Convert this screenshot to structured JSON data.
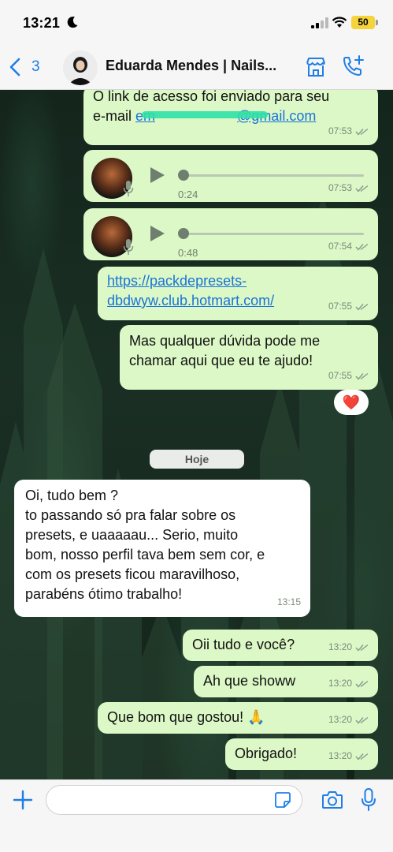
{
  "status_bar": {
    "time": "13:21",
    "battery": "50",
    "icons": [
      "moon-icon",
      "signal-icon",
      "wifi-icon",
      "battery-icon"
    ]
  },
  "header": {
    "back_count": "3",
    "contact_name": "Eduarda Mendes | Nails...",
    "icons": [
      "chevron-left-icon",
      "store-icon",
      "add-call-icon"
    ]
  },
  "chat": {
    "messages": [
      {
        "direction": "out",
        "line1": "O link de acesso foi enviado para seu",
        "line2_prefix": "e-mail ",
        "email_visible_start": "em",
        "email_visible_end": "@gmail.com",
        "time": "07:53"
      },
      {
        "direction": "out",
        "type": "voice",
        "duration": "0:24",
        "time": "07:53"
      },
      {
        "direction": "out",
        "type": "voice",
        "duration": "0:48",
        "time": "07:54"
      },
      {
        "direction": "out",
        "link_line1": "https://packdepresets-",
        "link_line2": "dbdwyw.club.hotmart.com/",
        "time": "07:55"
      },
      {
        "direction": "out",
        "line1": "Mas qualquer dúvida pode me",
        "line2": "chamar aqui que eu te ajudo!",
        "time": "07:55",
        "reaction": "❤️"
      },
      {
        "direction": "in",
        "lines": [
          "Oi, tudo bem ?",
          "to passando só pra falar sobre os",
          "presets, e uaaaaau... Serio, muito",
          "bom, nosso perfil tava bem sem cor, e",
          "com os presets ficou maravilhoso,",
          "parabéns ótimo trabalho!"
        ],
        "time": "13:15"
      },
      {
        "direction": "out",
        "text": "Oii tudo e você?",
        "time": "13:20"
      },
      {
        "direction": "out",
        "text": "Ah que showw",
        "time": "13:20"
      },
      {
        "direction": "out",
        "text": "Que bom que gostou! 🙏",
        "time": "13:20"
      },
      {
        "direction": "out",
        "text": "Obrigado!",
        "time": "13:20"
      }
    ],
    "date_separator": "Hoje"
  },
  "input_bar": {
    "placeholder": "",
    "icons": [
      "plus-icon",
      "sticker-icon",
      "camera-icon",
      "microphone-icon"
    ]
  },
  "colors": {
    "outgoing_bubble": "#dcf8c6",
    "incoming_bubble": "#ffffff",
    "accent": "#1f7ee6",
    "link": "#1a73d8"
  }
}
